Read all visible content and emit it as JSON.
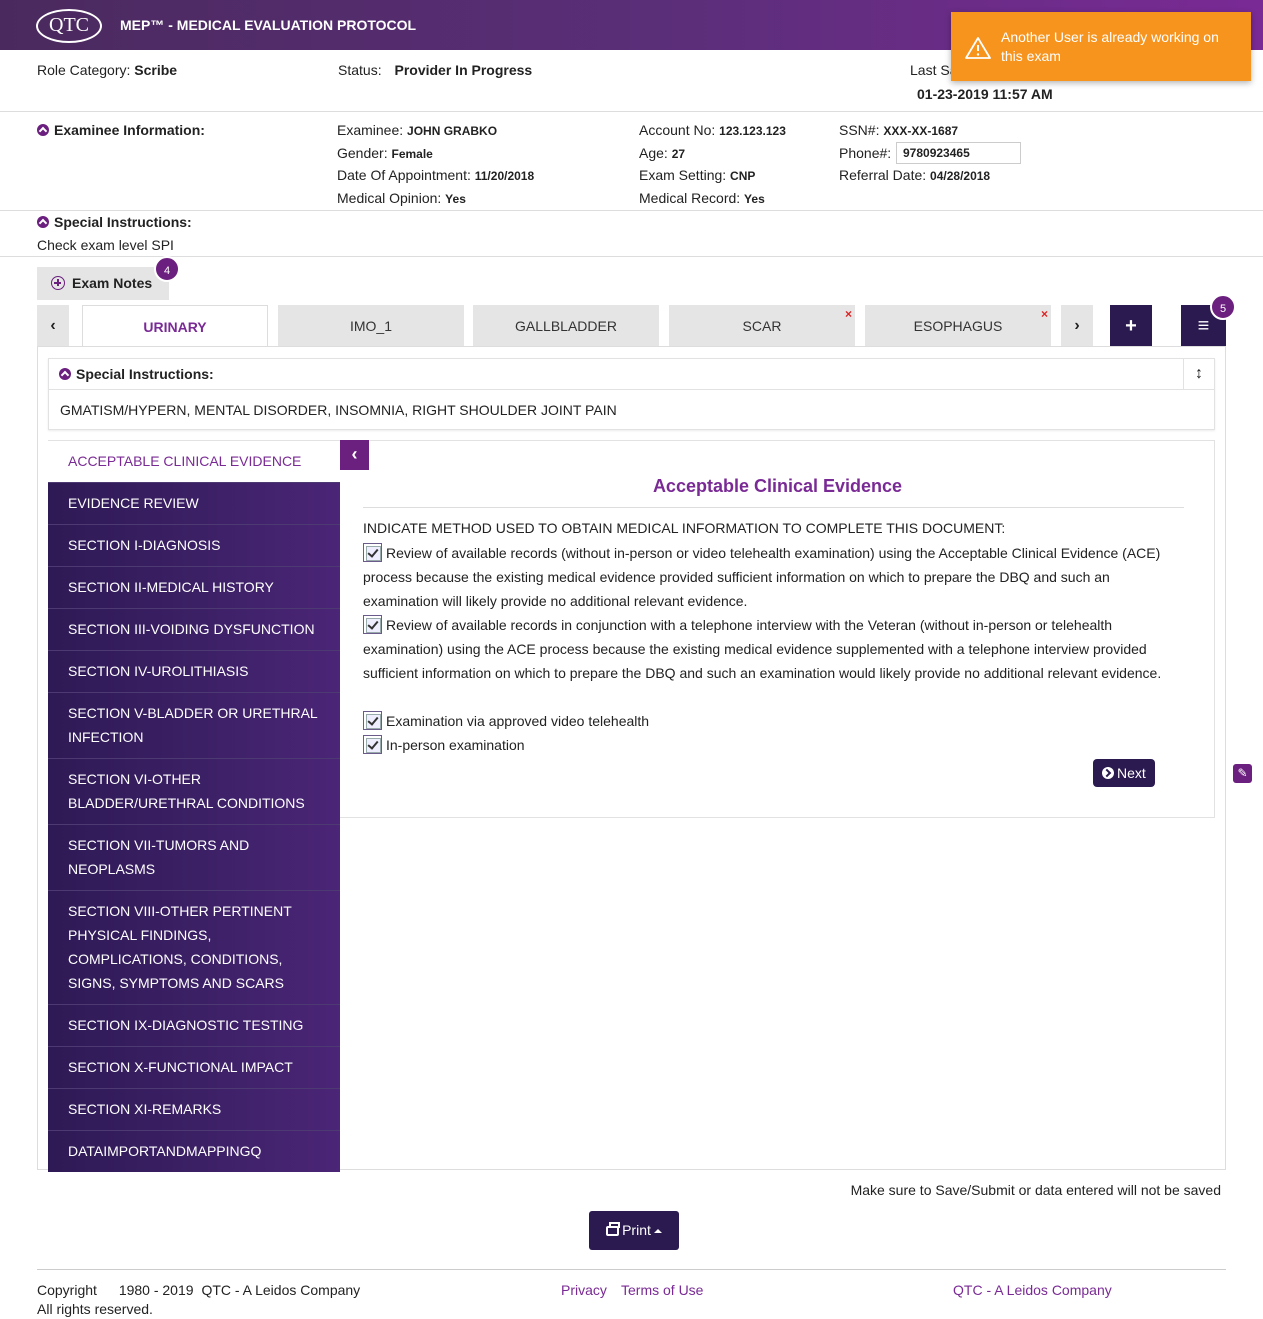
{
  "header": {
    "logo": "QTC",
    "title": "MEP™ - MEDICAL EVALUATION PROTOCOL"
  },
  "toast": {
    "message": "Another User is already working on this exam",
    "color": "#f7941d"
  },
  "status_bar": {
    "role_label": "Role Category:",
    "role_value": "Scribe",
    "status_label": "Status:",
    "status_value": "Provider In Progress",
    "last_saved_label": "Last Sa",
    "last_saved_value": "01-23-2019 11:57 AM"
  },
  "examinee": {
    "section_title": "Examinee Information:",
    "examinee_label": "Examinee:",
    "examinee_value": "JOHN GRABKO",
    "gender_label": "Gender:",
    "gender_value": "Female",
    "doa_label": "Date Of Appointment:",
    "doa_value": "11/20/2018",
    "opinion_label": "Medical Opinion:",
    "opinion_value": "Yes",
    "account_label": "Account No:",
    "account_value": "123.123.123",
    "age_label": "Age:",
    "age_value": "27",
    "setting_label": "Exam Setting:",
    "setting_value": "CNP",
    "record_label": "Medical Record:",
    "record_value": "Yes",
    "ssn_label": "SSN#:",
    "ssn_value": "XXX-XX-1687",
    "phone_label": "Phone#:",
    "phone_value": "9780923465",
    "referral_label": "Referral Date:",
    "referral_value": "04/28/2018"
  },
  "special_instructions": {
    "title": "Special Instructions:",
    "text": "Check exam level SPI"
  },
  "exam_notes": {
    "label": "Exam Notes",
    "count": "4"
  },
  "tabs": {
    "items": [
      {
        "label": "URINARY",
        "active": true,
        "closable": false
      },
      {
        "label": "IMO_1",
        "active": false,
        "closable": false
      },
      {
        "label": "GALLBLADDER",
        "active": false,
        "closable": false
      },
      {
        "label": "SCAR",
        "active": false,
        "closable": true
      },
      {
        "label": "ESOPHAGUS",
        "active": false,
        "closable": true
      }
    ],
    "close_mark": "×",
    "menu_count": "5"
  },
  "tab_spi": {
    "title": "Special Instructions:",
    "text": "GMATISM/HYPERN, MENTAL DISORDER, INSOMNIA, RIGHT SHOULDER JOINT PAIN"
  },
  "sidebar": {
    "active": "ACCEPTABLE CLINICAL EVIDENCE",
    "items": [
      "EVIDENCE REVIEW",
      "SECTION I-DIAGNOSIS",
      "SECTION II-MEDICAL HISTORY",
      "SECTION III-VOIDING DYSFUNCTION",
      "SECTION IV-UROLITHIASIS",
      "SECTION V-BLADDER OR URETHRAL INFECTION",
      "SECTION VI-OTHER BLADDER/URETHRAL CONDITIONS",
      "SECTION VII-TUMORS AND NEOPLASMS",
      "SECTION VIII-OTHER PERTINENT PHYSICAL FINDINGS, COMPLICATIONS, CONDITIONS, SIGNS, SYMPTOMS AND SCARS",
      "SECTION IX-DIAGNOSTIC TESTING",
      "SECTION X-FUNCTIONAL IMPACT",
      "SECTION XI-REMARKS",
      "DATAIMPORTANDMAPPINGQ"
    ]
  },
  "form": {
    "title": "Acceptable Clinical Evidence",
    "instruction": "INDICATE METHOD USED TO OBTAIN MEDICAL INFORMATION TO COMPLETE THIS DOCUMENT:",
    "options": [
      {
        "text": "Review of available records (without in-person or video telehealth examination) using the Acceptable Clinical Evidence (ACE) process because the existing medical evidence provided sufficient information on which to prepare the DBQ and such an examination will likely provide no additional relevant evidence.",
        "checked": true
      },
      {
        "text": "Review of available records in conjunction with a telephone interview with the Veteran (without in-person or telehealth examination) using the ACE process because the existing medical evidence supplemented with a telephone interview provided sufficient information on which to prepare the DBQ and such an examination would likely provide no additional relevant evidence.",
        "checked": true
      },
      {
        "text": "Examination via approved video telehealth",
        "checked": true
      },
      {
        "text": "In-person examination",
        "checked": true
      }
    ],
    "next_label": "Next"
  },
  "bottom": {
    "save_note": "Make sure to Save/Submit or data entered will not be saved",
    "print_label": "Print"
  },
  "footer": {
    "copyright": "Copyright",
    "years": "1980 - 2019",
    "company": "QTC - A Leidos Company",
    "rights": "All rights reserved.",
    "privacy": "Privacy",
    "terms": "Terms of Use",
    "brand_link": "QTC - A Leidos Company"
  },
  "colors": {
    "brand_purple": "#6b1f7e",
    "dark_navy": "#2a1a4f",
    "accent_text": "#7a2a95"
  }
}
